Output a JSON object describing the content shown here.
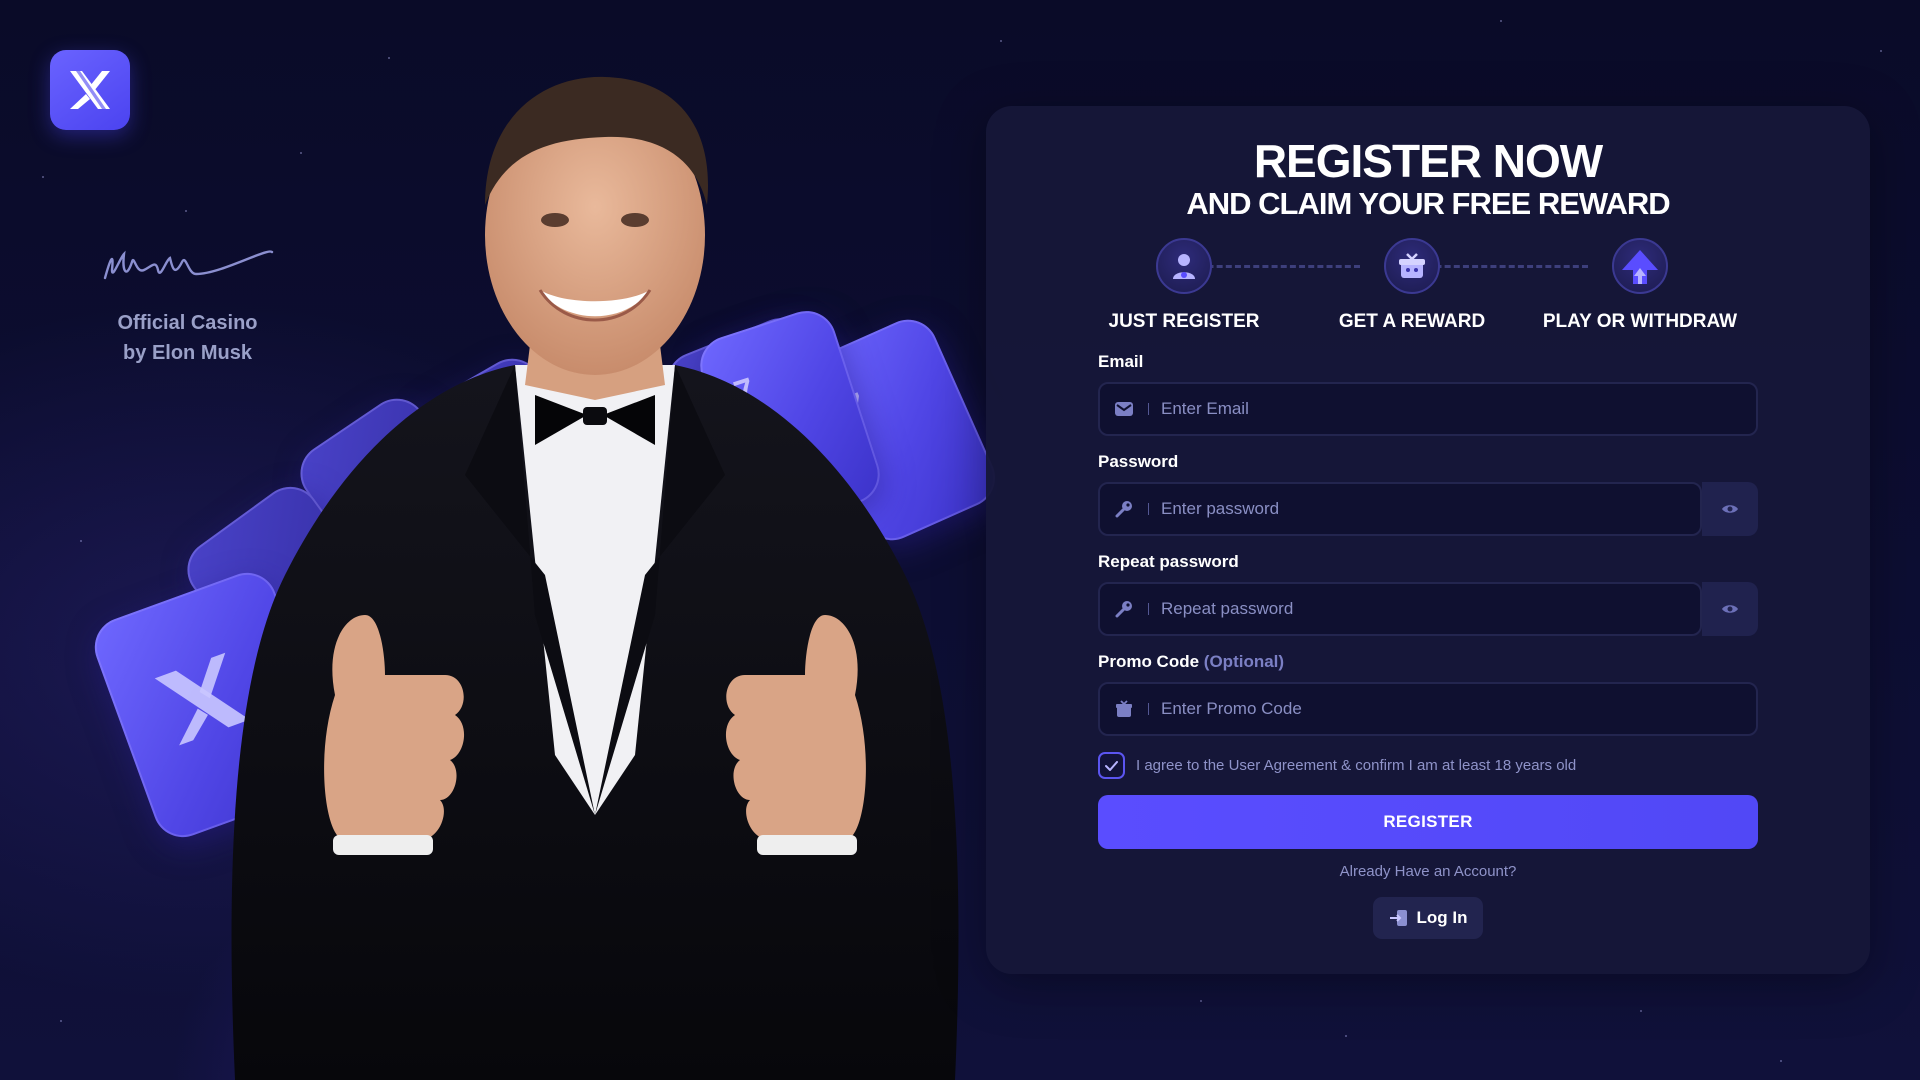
{
  "brand": {
    "tagline_line1": "Official Casino",
    "tagline_line2": "by Elon Musk"
  },
  "register": {
    "title": "REGISTER NOW",
    "subtitle": "AND CLAIM YOUR FREE REWARD",
    "steps": [
      {
        "label": "JUST REGISTER",
        "icon": "user-icon"
      },
      {
        "label": "GET A REWARD",
        "icon": "gift-icon"
      },
      {
        "label": "PLAY OR WITHDRAW",
        "icon": "arrow-up-icon"
      }
    ],
    "email": {
      "label": "Email",
      "placeholder": "Enter Email"
    },
    "password": {
      "label": "Password",
      "placeholder": "Enter password"
    },
    "repeat_password": {
      "label": "Repeat password",
      "placeholder": "Repeat password"
    },
    "promo": {
      "label": "Promo Code",
      "optional": "(Optional)",
      "placeholder": "Enter Promo Code"
    },
    "agreement": {
      "text": "I agree to the User Agreement & confirm I am at least 18 years old",
      "checked": true
    },
    "submit_label": "REGISTER",
    "already_text": "Already Have an Account?",
    "login_label": "Log In"
  },
  "colors": {
    "accent": "#5a4dff",
    "background": "#0b0c2c",
    "panel": "#161738"
  }
}
